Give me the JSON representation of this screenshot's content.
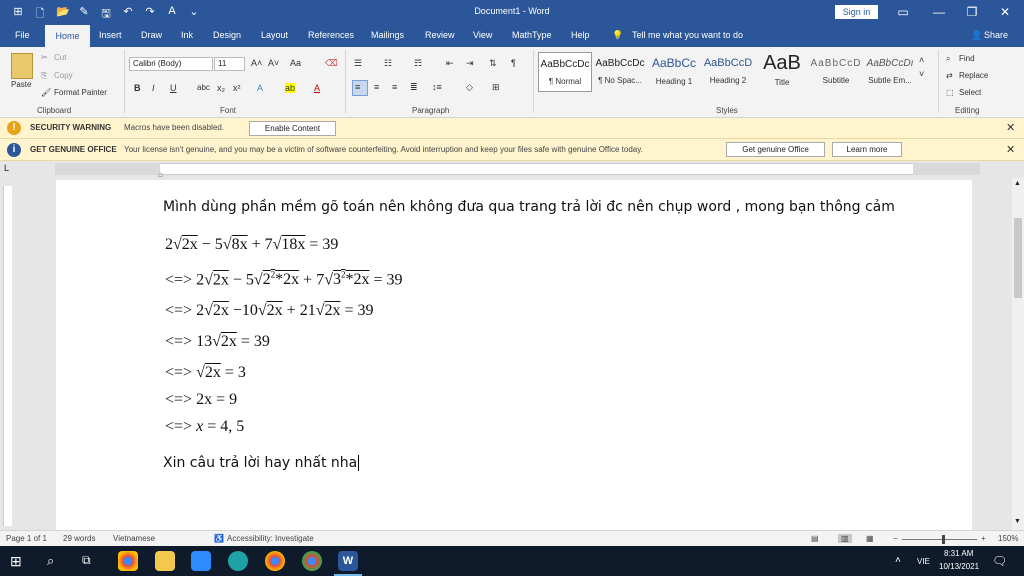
{
  "titlebar": {
    "title": "Document1 - Word",
    "signin": "Sign in"
  },
  "tabs": [
    "File",
    "Home",
    "Insert",
    "Draw",
    "Ink",
    "Design",
    "Layout",
    "References",
    "Mailings",
    "Review",
    "View",
    "MathType",
    "Help"
  ],
  "tellme": "Tell me what you want to do",
  "share": "Share",
  "clipboard": {
    "paste": "Paste",
    "cut": "Cut",
    "copy": "Copy",
    "format_painter": "Format Painter",
    "group": "Clipboard"
  },
  "font": {
    "name": "Calibri (Body)",
    "size": "11",
    "group": "Font"
  },
  "paragraph": {
    "group": "Paragraph"
  },
  "styles": {
    "group": "Styles",
    "items": [
      {
        "preview": "AaBbCcDc",
        "name": "¶ Normal"
      },
      {
        "preview": "AaBbCcDc",
        "name": "¶ No Spac..."
      },
      {
        "preview": "AaBbCc",
        "name": "Heading 1"
      },
      {
        "preview": "AaBbCcD",
        "name": "Heading 2"
      },
      {
        "preview": "AaB",
        "name": "Title"
      },
      {
        "preview": "AaBbCcD",
        "name": "Subtitle"
      },
      {
        "preview": "AaBbCcDı",
        "name": "Subtle Em..."
      }
    ]
  },
  "editing": {
    "group": "Editing",
    "find": "Find",
    "replace": "Replace",
    "select": "Select"
  },
  "security": {
    "heading": "SECURITY WARNING",
    "message": "Macros have been disabled.",
    "button": "Enable Content"
  },
  "genuine": {
    "heading": "GET GENUINE OFFICE",
    "message": "Your license isn't genuine, and you may be a victim of software counterfeiting. Avoid interruption and keep your files safe with genuine Office today.",
    "button1": "Get genuine Office",
    "button2": "Learn more"
  },
  "document": {
    "intro": "Mình dùng phần mềm gõ toán nên không đưa qua trang trả lời đc nên chụp word , mong bạn thông cảm",
    "outro": "Xin câu trả lời hay nhất nha"
  },
  "status": {
    "page": "Page 1 of 1",
    "words": "29 words",
    "language": "Vietnamese",
    "accessibility": "Accessibility: Investigate",
    "zoom": "150%"
  },
  "taskbar": {
    "lang": "VIE",
    "time": "8:31 AM",
    "date": "10/13/2021"
  },
  "colors": {
    "brand": "#2b579a",
    "warning": "#fff4ce"
  }
}
